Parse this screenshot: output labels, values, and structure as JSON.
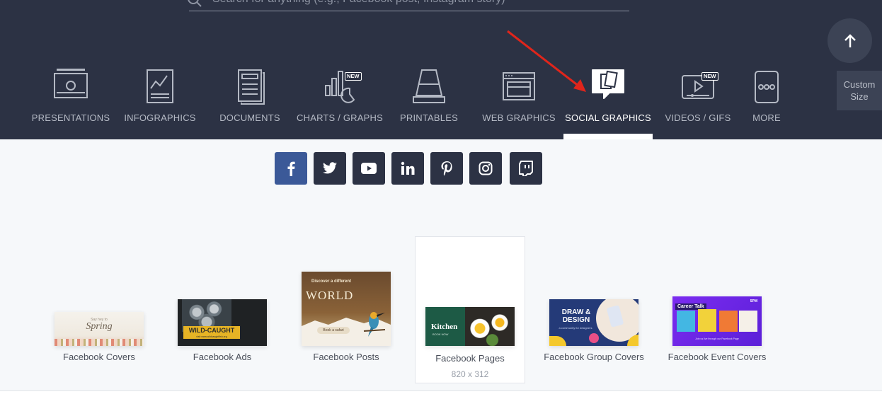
{
  "search": {
    "placeholder": "Search for anything (e.g., Facebook post, Instagram story)"
  },
  "categories": [
    {
      "label": "PRESENTATIONS",
      "icon": "presentation-icon"
    },
    {
      "label": "INFOGRAPHICS",
      "icon": "infographic-icon"
    },
    {
      "label": "DOCUMENTS",
      "icon": "document-icon"
    },
    {
      "label": "CHARTS / GRAPHS",
      "icon": "chart-icon",
      "badge": "NEW"
    },
    {
      "label": "PRINTABLES",
      "icon": "printer-icon"
    },
    {
      "label": "WEB GRAPHICS",
      "icon": "browser-icon"
    },
    {
      "label": "SOCIAL GRAPHICS",
      "icon": "social-icon",
      "active": true
    },
    {
      "label": "VIDEOS / GIFS",
      "icon": "video-icon",
      "badge": "NEW"
    },
    {
      "label": "MORE",
      "icon": "more-icon"
    }
  ],
  "custom_size": "Custom Size",
  "social_networks": [
    "facebook",
    "twitter",
    "youtube",
    "linkedin",
    "pinterest",
    "instagram",
    "twitch"
  ],
  "templates": [
    {
      "label": "Facebook Covers",
      "thumb_text": "Spring",
      "thumb_small": "Say hey to"
    },
    {
      "label": "Facebook Ads",
      "thumb_text": "WILD-CAUGHT",
      "thumb_small": "visit www.wildcaughtfish.org"
    },
    {
      "label": "Facebook Posts",
      "thumb_text": "WORLD",
      "thumb_small": "Discover a different",
      "thumb_button": "Book a safari"
    },
    {
      "label": "Facebook Pages",
      "size": "820 x 312",
      "thumb_text": "Kitchen",
      "thumb_small": "BOOK NOW",
      "selected": true
    },
    {
      "label": "Facebook Group Covers",
      "thumb_text": "DRAW & DESIGN",
      "thumb_small": "a community for designers"
    },
    {
      "label": "Facebook Event Covers",
      "thumb_text": "Career Talk",
      "thumb_small": "Join us live through our Facebook Page",
      "thumb_badge": "5PM"
    }
  ],
  "colors": {
    "header_bg": "#2c3244",
    "facebook": "#3b5998",
    "arrow": "#e0251b"
  }
}
